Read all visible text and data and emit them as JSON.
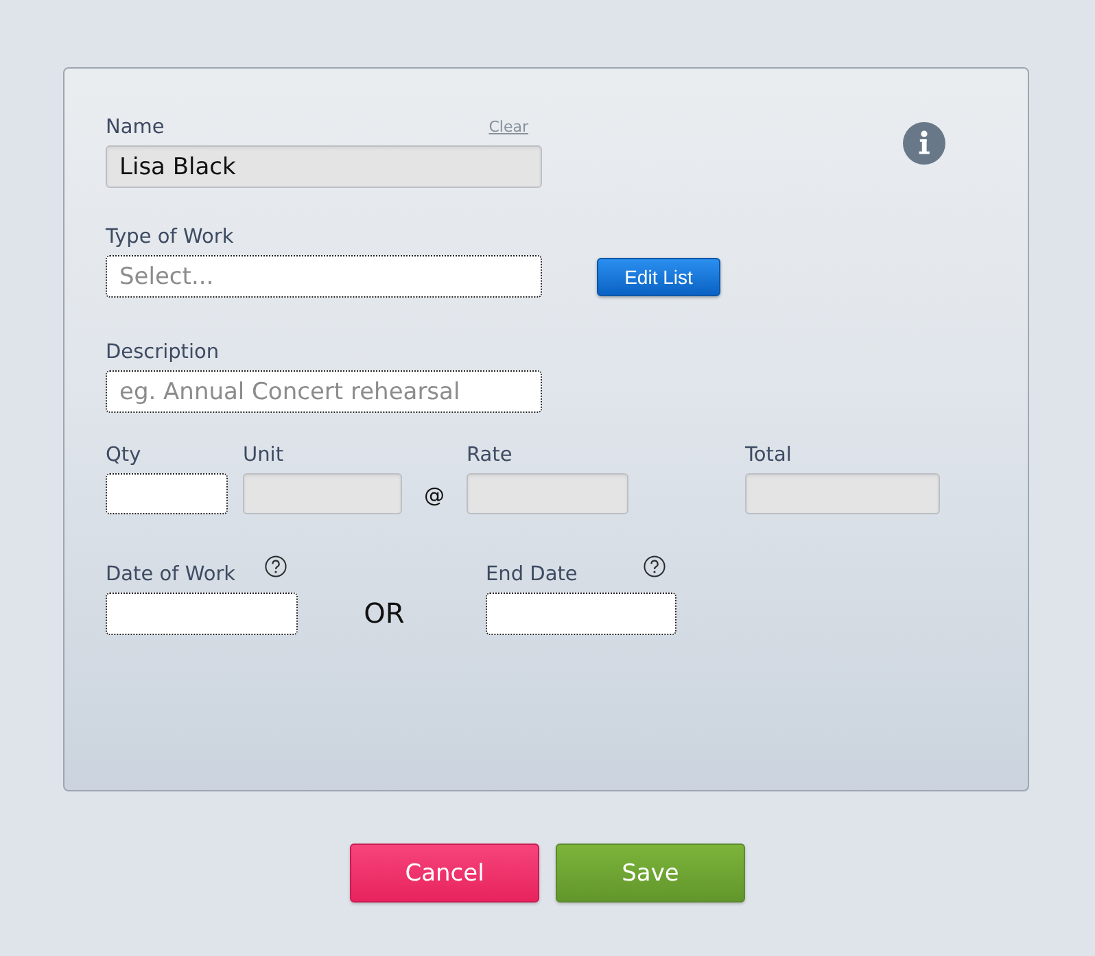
{
  "name": {
    "label": "Name",
    "link": "Clear",
    "value": "Lisa Black",
    "disabled": true
  },
  "type_of_work": {
    "label": "Type of Work",
    "placeholder": "Select...",
    "disabled": false,
    "button": "Edit List"
  },
  "description": {
    "label": "Description",
    "placeholder": "eg. Annual Concert rehearsal",
    "disabled": false
  },
  "amount_row": {
    "fields": [
      {
        "label": "Qty",
        "disabled": false
      },
      {
        "label": "Unit",
        "disabled": true
      },
      {
        "label": "Rate",
        "disabled": true
      },
      {
        "label": "Total",
        "disabled": true
      }
    ],
    "separator": "@"
  },
  "dates": {
    "fields": [
      {
        "label": "Date of Work",
        "disabled": false
      },
      {
        "label": "End Date",
        "disabled": false
      }
    ],
    "separator": "OR"
  },
  "buttons": [
    {
      "label": "Cancel",
      "kind": "cancel"
    },
    {
      "label": "Save",
      "kind": "save"
    }
  ]
}
